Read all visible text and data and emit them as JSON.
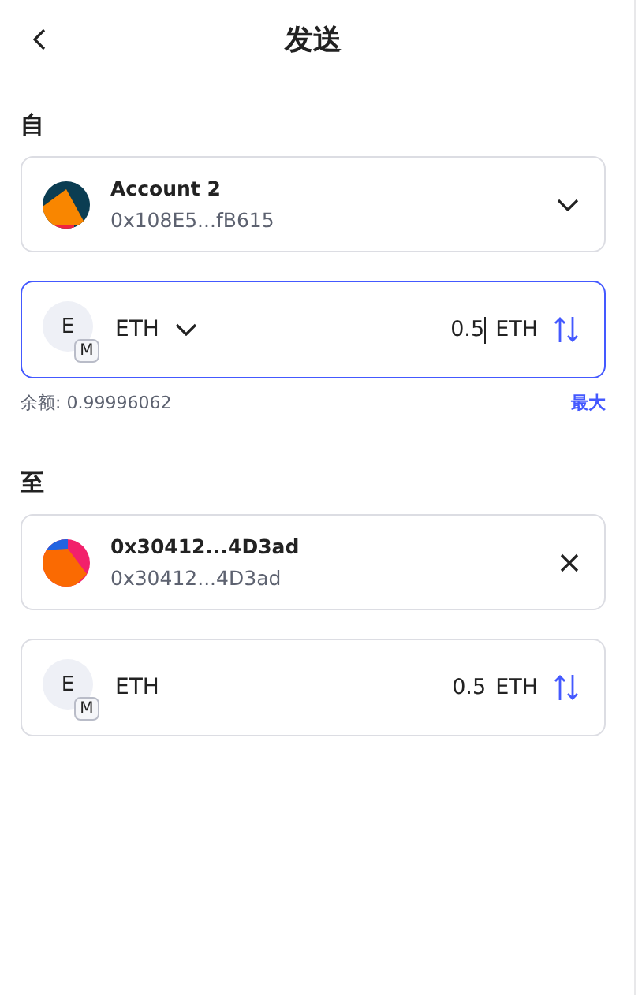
{
  "header": {
    "title": "发送"
  },
  "from": {
    "label": "自",
    "account": {
      "name": "Account 2",
      "address": "0x108E5...fB615"
    },
    "asset": {
      "avatar_letter": "E",
      "network_badge": "M",
      "symbol": "ETH",
      "has_dropdown": true,
      "amount": "0.5",
      "unit": "ETH",
      "focused": true
    },
    "balance": "余额: 0.99996062",
    "max_link": "最大"
  },
  "to": {
    "label": "至",
    "recipient": {
      "name": "0x30412...4D3ad",
      "address": "0x30412...4D3ad"
    },
    "asset": {
      "avatar_letter": "E",
      "network_badge": "M",
      "symbol": "ETH",
      "has_dropdown": false,
      "amount": "0.5",
      "unit": "ETH",
      "focused": false
    }
  }
}
